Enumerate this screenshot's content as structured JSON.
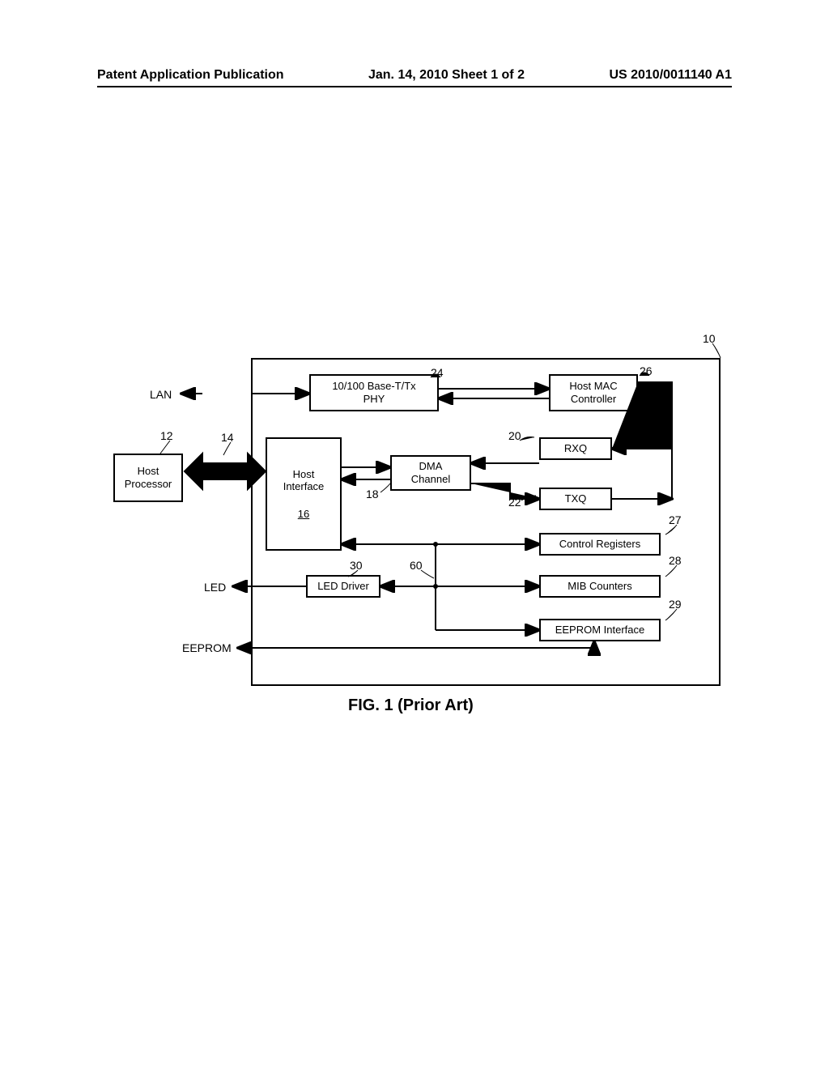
{
  "header": {
    "left": "Patent Application Publication",
    "center": "Jan. 14, 2010  Sheet 1 of 2",
    "right": "US 2010/0011140 A1"
  },
  "labels": {
    "lan": "LAN",
    "led": "LED",
    "eeprom": "EEPROM"
  },
  "blocks": {
    "host_processor": "Host\nProcessor",
    "host_interface": "Host\nInterface",
    "host_interface_ref": "16",
    "phy": "10/100 Base-T/Tx\nPHY",
    "dma": "DMA\nChannel",
    "rxq": "RXQ",
    "txq": "TXQ",
    "host_mac": "Host MAC\nController",
    "control_registers": "Control Registers",
    "mib_counters": "MIB Counters",
    "eeprom_if": "EEPROM Interface",
    "led_driver": "LED Driver"
  },
  "refs": {
    "r10": "10",
    "r12": "12",
    "r14": "14",
    "r18": "18",
    "r20": "20",
    "r22": "22",
    "r24": "24",
    "r26": "26",
    "r27": "27",
    "r28": "28",
    "r29": "29",
    "r30": "30",
    "r60": "60"
  },
  "caption": "FIG. 1  (Prior Art)"
}
